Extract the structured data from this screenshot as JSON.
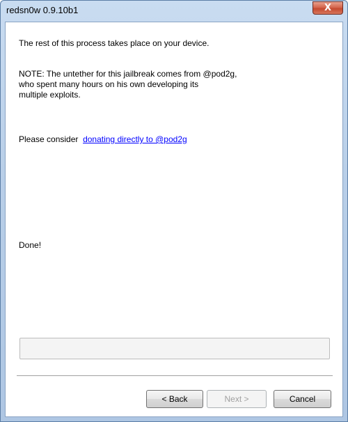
{
  "window": {
    "title": "redsn0w 0.9.10b1",
    "close_glyph": "X"
  },
  "content": {
    "line1": "The rest of this process takes place on your device.",
    "note_lines": [
      "NOTE: The untether for this jailbreak comes from @pod2g,",
      "who spent many hours on his own developing its",
      "multiple exploits."
    ],
    "donate_prefix": "Please consider",
    "donate_link": "donating directly to @pod2g",
    "status": "Done!"
  },
  "progress": {
    "value": 0
  },
  "buttons": {
    "back": "< Back",
    "next": "Next >",
    "cancel": "Cancel",
    "next_enabled": false
  },
  "colors": {
    "link": "#0000ff",
    "disabled_text": "#a0a0a0"
  }
}
